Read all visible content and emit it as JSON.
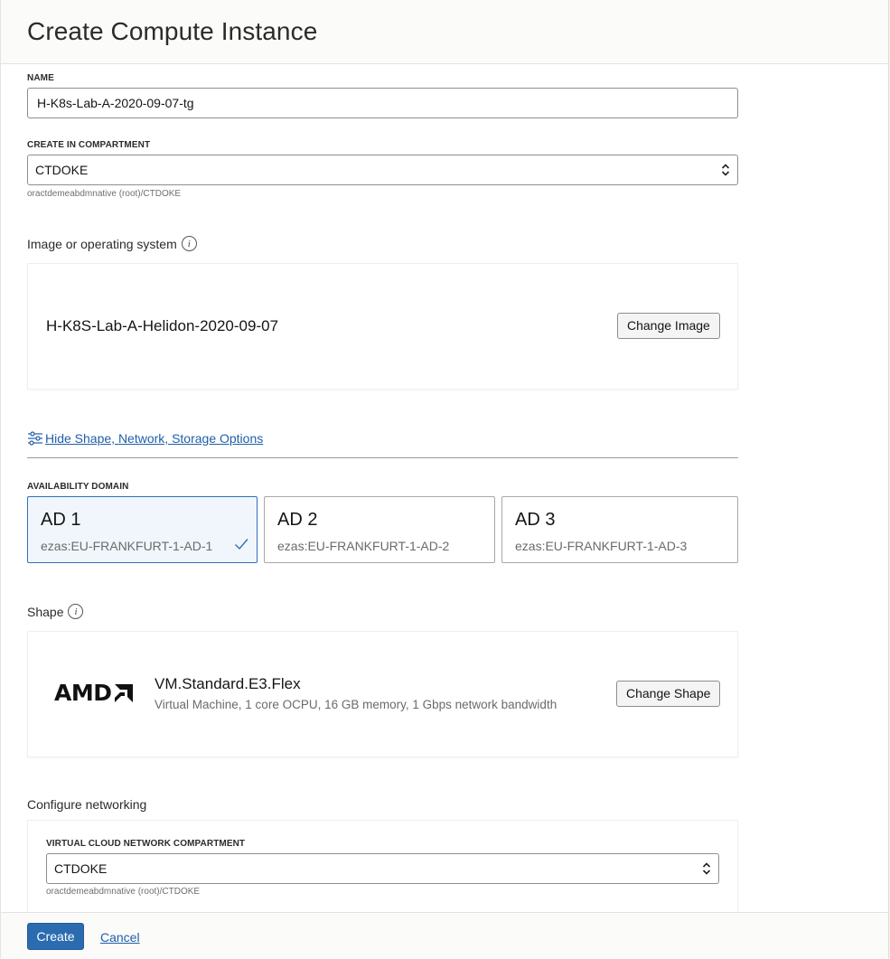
{
  "header": {
    "title": "Create Compute Instance"
  },
  "name_field": {
    "label": "NAME",
    "value": "H-K8s-Lab-A-2020-09-07-tg"
  },
  "compartment": {
    "label": "CREATE IN COMPARTMENT",
    "value": "CTDOKE",
    "helper": "oractdemeabdmnative (root)/CTDOKE"
  },
  "image": {
    "label": "Image or operating system",
    "name": "H-K8S-Lab-A-Helidon-2020-09-07",
    "change_label": "Change Image"
  },
  "options_link": "Hide Shape, Network, Storage Options",
  "availability_domain": {
    "label": "AVAILABILITY DOMAIN",
    "domains": [
      {
        "title": "AD 1",
        "sub": "ezas:EU-FRANKFURT-1-AD-1",
        "selected": true
      },
      {
        "title": "AD 2",
        "sub": "ezas:EU-FRANKFURT-1-AD-2",
        "selected": false
      },
      {
        "title": "AD 3",
        "sub": "ezas:EU-FRANKFURT-1-AD-3",
        "selected": false
      }
    ]
  },
  "shape": {
    "label": "Shape",
    "brand": "AMD",
    "name": "VM.Standard.E3.Flex",
    "description": "Virtual Machine, 1 core OCPU, 16 GB memory, 1 Gbps network bandwidth",
    "change_label": "Change Shape"
  },
  "networking": {
    "label": "Configure networking",
    "vcn_compartment_label": "VIRTUAL CLOUD NETWORK COMPARTMENT",
    "vcn_compartment_value": "CTDOKE",
    "vcn_compartment_helper": "oractdemeabdmnative (root)/CTDOKE"
  },
  "footer": {
    "create_label": "Create",
    "cancel_label": "Cancel"
  },
  "colors": {
    "accent": "#2b6cb0",
    "link": "#1f5fa8",
    "selected_bg": "#f0f6fc"
  }
}
